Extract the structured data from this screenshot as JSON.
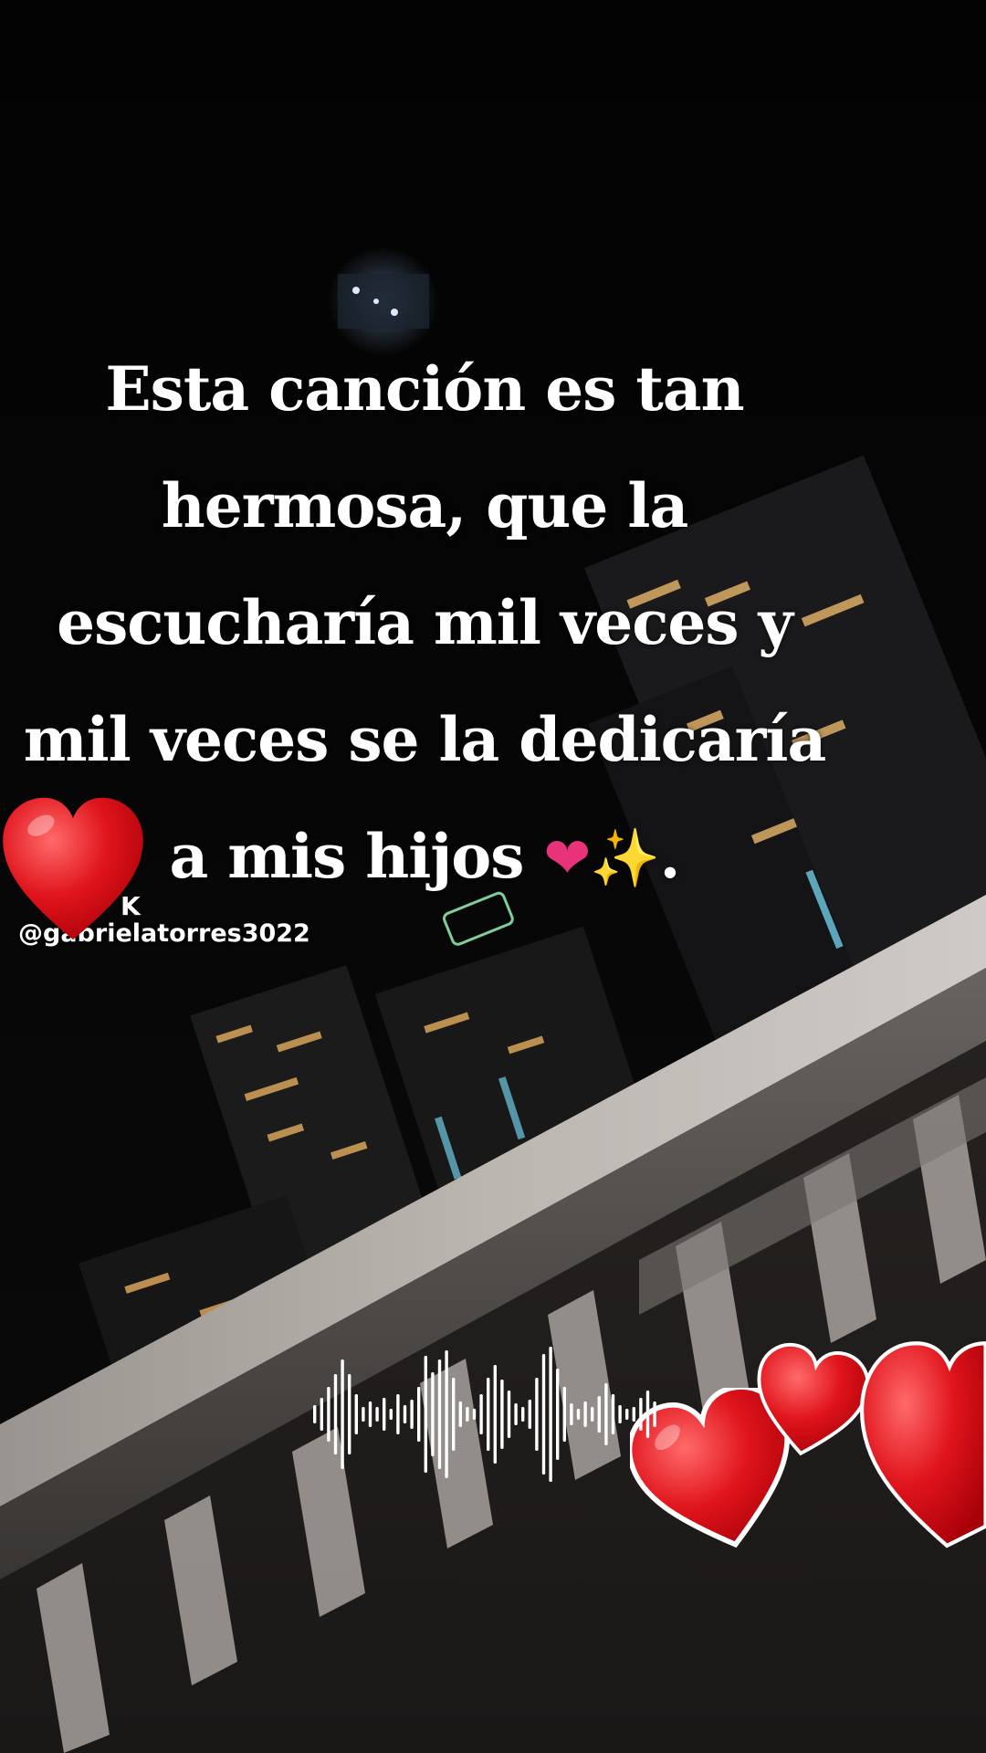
{
  "caption": {
    "lines": [
      "Esta canción es tan",
      "hermosa, que la",
      "escucharía mil veces y",
      "mil veces se la dedicaría"
    ],
    "last_line_text": "a mis hijos",
    "last_line_emojis": [
      "growing-heart-emoji",
      "sparkles-emoji"
    ],
    "growing_heart_glyph": "❤",
    "sparkles_glyph": "✨",
    "last_line_punct": "."
  },
  "watermark": {
    "brand": "K",
    "handle": "@gabrielatorres3022"
  },
  "decorations": {
    "hearts": [
      "red-heart-icon",
      "red-heart-icon",
      "red-heart-icon",
      "red-heart-icon"
    ],
    "audio_waveform": "audio-waveform-icon"
  },
  "colors": {
    "heart_red": "#e0141c",
    "heart_pink": "#e8337a",
    "sparkles": "#ffd21f",
    "caption_text": "#ffffff"
  }
}
